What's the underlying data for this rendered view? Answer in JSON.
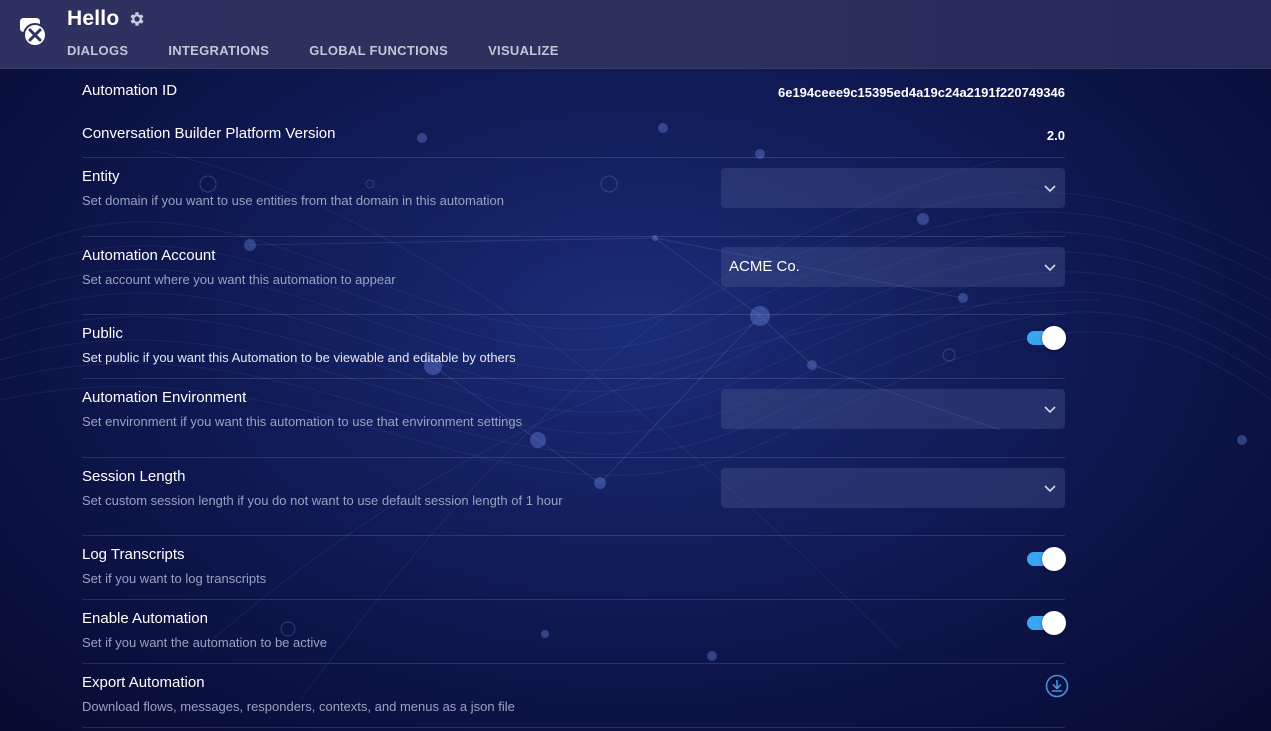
{
  "header": {
    "title": "Hello",
    "icons": {
      "logo": "chat-bubbles-logo",
      "settings": "gear-icon"
    },
    "tabs": [
      {
        "label": "DIALOGS"
      },
      {
        "label": "INTEGRATIONS"
      },
      {
        "label": "GLOBAL FUNCTIONS"
      },
      {
        "label": "VISUALIZE"
      }
    ]
  },
  "settings": {
    "automation_id": {
      "label": "Automation ID",
      "value": "6e194ceee9c15395ed4a19c24a2191f220749346"
    },
    "platform_version": {
      "label": "Conversation Builder Platform Version",
      "value": "2.0"
    },
    "entity": {
      "label": "Entity",
      "description": "Set domain if you want to use entities from that domain in this automation",
      "selected": ""
    },
    "account": {
      "label": "Automation Account",
      "description": "Set account where you want this automation to appear",
      "selected": "ACME Co."
    },
    "public": {
      "label": "Public",
      "description": "Set public if you want this Automation to be viewable and editable by others",
      "enabled": true
    },
    "environment": {
      "label": "Automation Environment",
      "description": "Set environment if you want this automation to use that environment settings",
      "selected": ""
    },
    "session_length": {
      "label": "Session Length",
      "description": "Set custom session length if you do not want to use default session length of 1 hour",
      "selected": ""
    },
    "log_transcripts": {
      "label": "Log Transcripts",
      "description": "Set if you want to log transcripts",
      "enabled": true
    },
    "enable_automation": {
      "label": "Enable Automation",
      "description": "Set if you want the automation to be active",
      "enabled": true
    },
    "export": {
      "label": "Export Automation",
      "description": "Download flows, messages, responders, contexts, and menus as a json file",
      "icon": "download-icon"
    }
  },
  "colors": {
    "accent": "#3ba6f0",
    "header_bg": "#2f3160",
    "page_bg": "#101a55"
  }
}
